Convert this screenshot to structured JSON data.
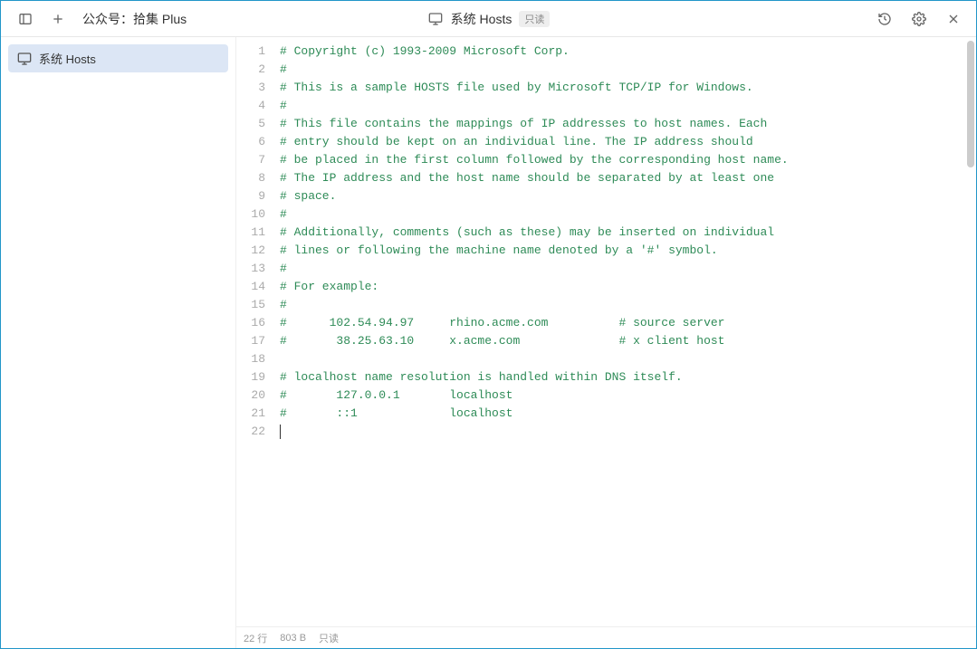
{
  "titlebar": {
    "app_name": "公众号：拾集 Plus",
    "center_title": "系统 Hosts",
    "readonly_badge": "只读"
  },
  "sidebar": {
    "items": [
      {
        "label": "系统 Hosts",
        "active": true
      }
    ]
  },
  "editor": {
    "lines": [
      "# Copyright (c) 1993-2009 Microsoft Corp.",
      "#",
      "# This is a sample HOSTS file used by Microsoft TCP/IP for Windows.",
      "#",
      "# This file contains the mappings of IP addresses to host names. Each",
      "# entry should be kept on an individual line. The IP address should",
      "# be placed in the first column followed by the corresponding host name.",
      "# The IP address and the host name should be separated by at least one",
      "# space.",
      "#",
      "# Additionally, comments (such as these) may be inserted on individual",
      "# lines or following the machine name denoted by a '#' symbol.",
      "#",
      "# For example:",
      "#",
      "#      102.54.94.97     rhino.acme.com          # source server",
      "#       38.25.63.10     x.acme.com              # x client host",
      "",
      "# localhost name resolution is handled within DNS itself.",
      "#\t127.0.0.1       localhost",
      "#\t::1             localhost",
      ""
    ]
  },
  "statusbar": {
    "lines_label": "22 行",
    "size_label": "803 B",
    "readonly_label": "只读"
  }
}
